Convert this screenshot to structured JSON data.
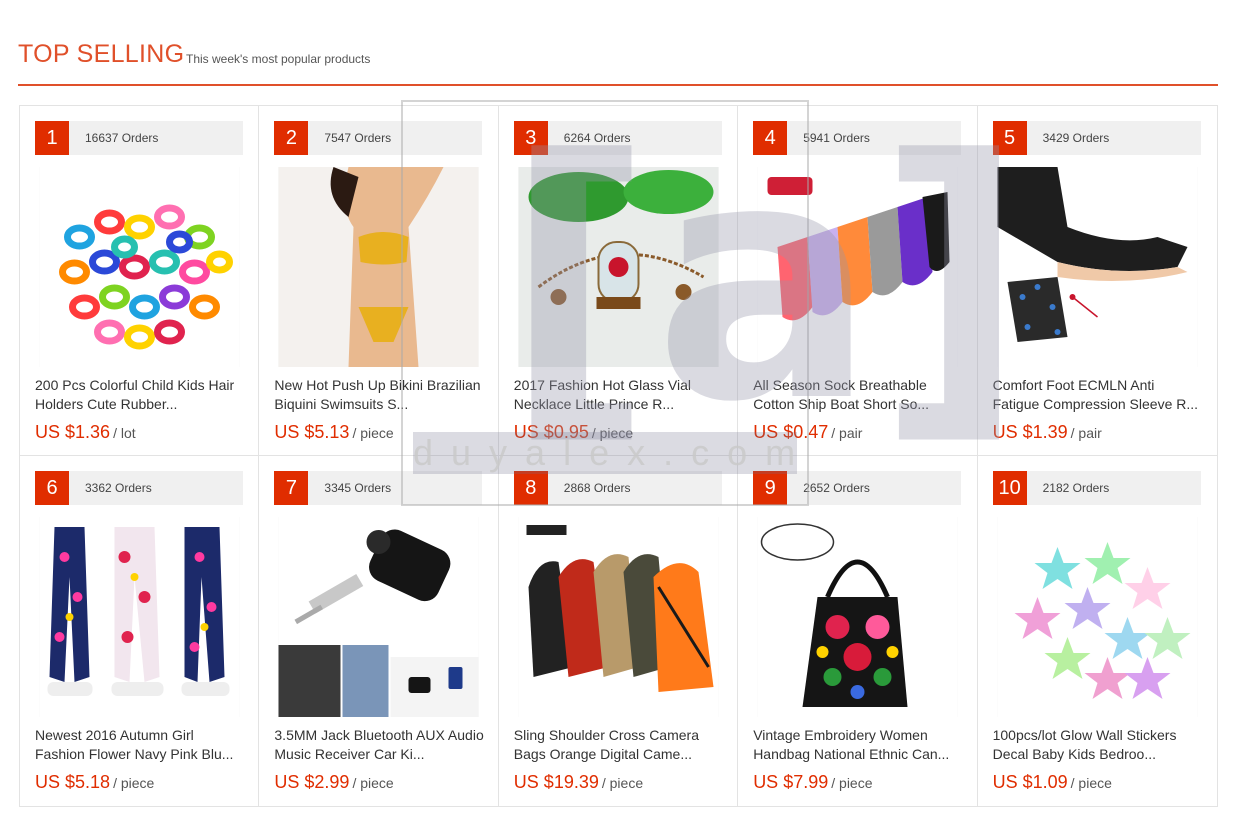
{
  "header": {
    "title": "TOP SELLING",
    "subtitle": "This week's most popular products"
  },
  "products": [
    {
      "rank": "1",
      "orders": "16637 Orders",
      "name": "200 Pcs Colorful Child Kids Hair Holders Cute Rubber...",
      "price": "US $1.36",
      "unit": "/ lot",
      "image": "hair-ties-image"
    },
    {
      "rank": "2",
      "orders": "7547 Orders",
      "name": "New Hot Push Up Bikini Brazilian Biquini Swimsuits S...",
      "price": "US $5.13",
      "unit": "/ piece",
      "image": "bikini-image"
    },
    {
      "rank": "3",
      "orders": "6264 Orders",
      "name": "2017 Fashion Hot Glass Vial Necklace Little Prince R...",
      "price": "US $0.95",
      "unit": "/ piece",
      "image": "necklace-image"
    },
    {
      "rank": "4",
      "orders": "5941 Orders",
      "name": "All Season Sock Breathable Cotton Ship Boat Short So...",
      "price": "US $0.47",
      "unit": "/ pair",
      "image": "socks-image"
    },
    {
      "rank": "5",
      "orders": "3429 Orders",
      "name": "Comfort Foot ECMLN Anti Fatigue Compression Sleeve R...",
      "price": "US $1.39",
      "unit": "/ pair",
      "image": "compression-sleeve-image"
    },
    {
      "rank": "6",
      "orders": "3362 Orders",
      "name": "Newest 2016 Autumn Girl Fashion Flower Navy Pink Blu...",
      "price": "US $5.18",
      "unit": "/ piece",
      "image": "leggings-image"
    },
    {
      "rank": "7",
      "orders": "3345 Orders",
      "name": "3.5MM Jack Bluetooth AUX Audio Music Receiver Car Ki...",
      "price": "US $2.99",
      "unit": "/ piece",
      "image": "bluetooth-receiver-image"
    },
    {
      "rank": "8",
      "orders": "2868 Orders",
      "name": "Sling Shoulder Cross Camera Bags Orange Digital Came...",
      "price": "US $19.39",
      "unit": "/ piece",
      "image": "camera-bags-image"
    },
    {
      "rank": "9",
      "orders": "2652 Orders",
      "name": "Vintage Embroidery Women Handbag National Ethnic Can...",
      "price": "US $7.99",
      "unit": "/ piece",
      "image": "handbag-image"
    },
    {
      "rank": "10",
      "orders": "2182 Orders",
      "name": "100pcs/lot Glow Wall Stickers Decal Baby Kids Bedroo...",
      "price": "US $1.09",
      "unit": "/ piece",
      "image": "star-stickers-image"
    }
  ],
  "watermark": {
    "text": "duyalex.com"
  },
  "colors": {
    "accent": "#e0502a",
    "rank_badge": "#e02d00",
    "price": "#e02d00"
  }
}
